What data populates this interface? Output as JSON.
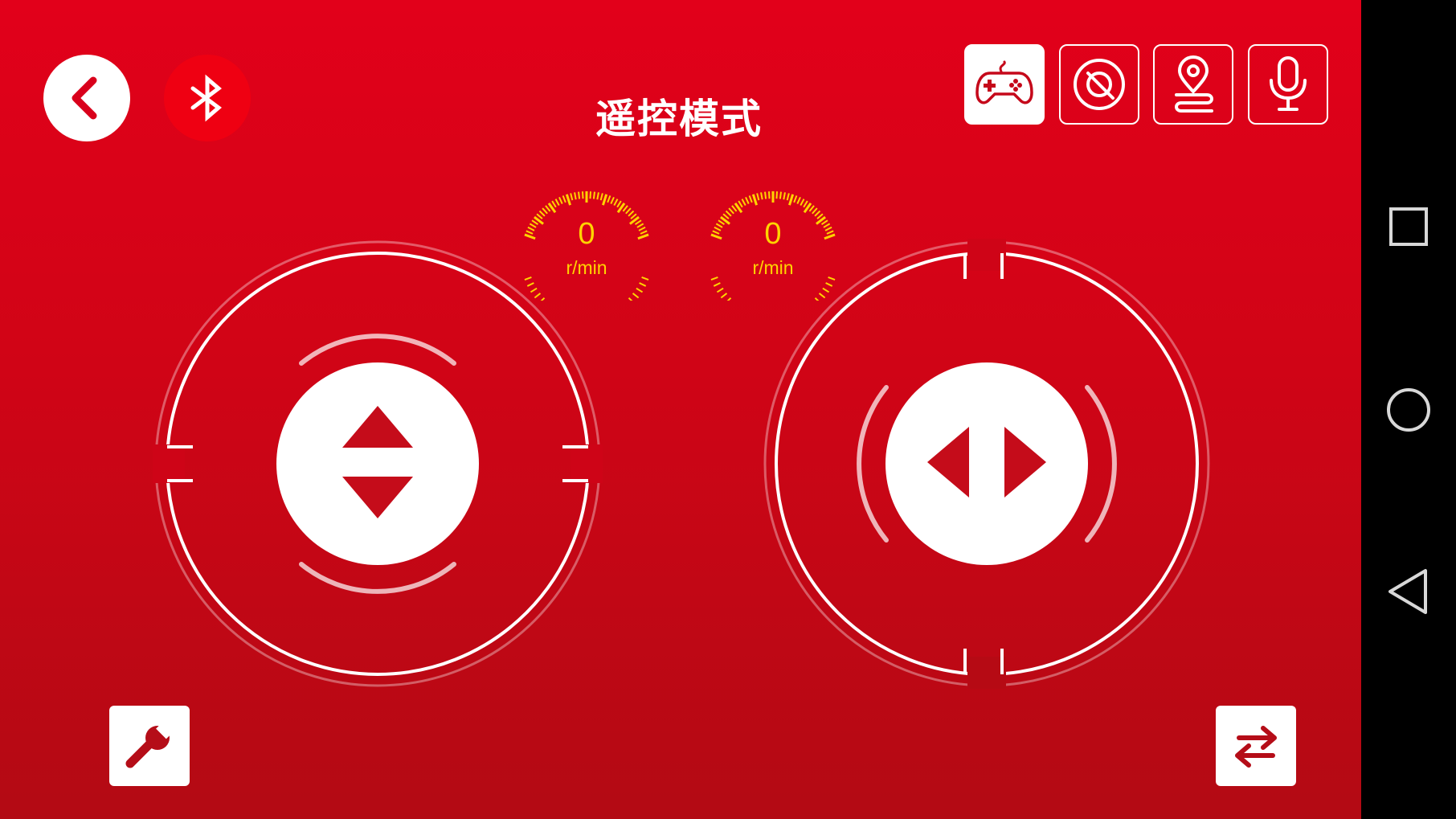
{
  "header": {
    "title": "遥控模式"
  },
  "toolbar": {
    "back_icon": "chevron-left-icon",
    "bluetooth_icon": "bluetooth-icon"
  },
  "modes": [
    {
      "name": "gamepad",
      "icon": "gamepad-icon",
      "active": true
    },
    {
      "name": "obstacle",
      "icon": "obstacle-avoid-icon",
      "active": false
    },
    {
      "name": "track",
      "icon": "location-track-icon",
      "active": false
    },
    {
      "name": "voice",
      "icon": "microphone-icon",
      "active": false
    }
  ],
  "gauges": {
    "left": {
      "value": "0",
      "unit": "r/min"
    },
    "right": {
      "value": "0",
      "unit": "r/min"
    }
  },
  "controls": {
    "left_joystick_icon": "up-down-arrows-icon",
    "right_joystick_icon": "left-right-arrows-icon",
    "settings_icon": "wrench-icon",
    "swap_icon": "swap-arrows-icon"
  },
  "colors": {
    "accent": "#e2001a",
    "accent_dark": "#b30a14",
    "gauge_text": "#ffd400"
  }
}
